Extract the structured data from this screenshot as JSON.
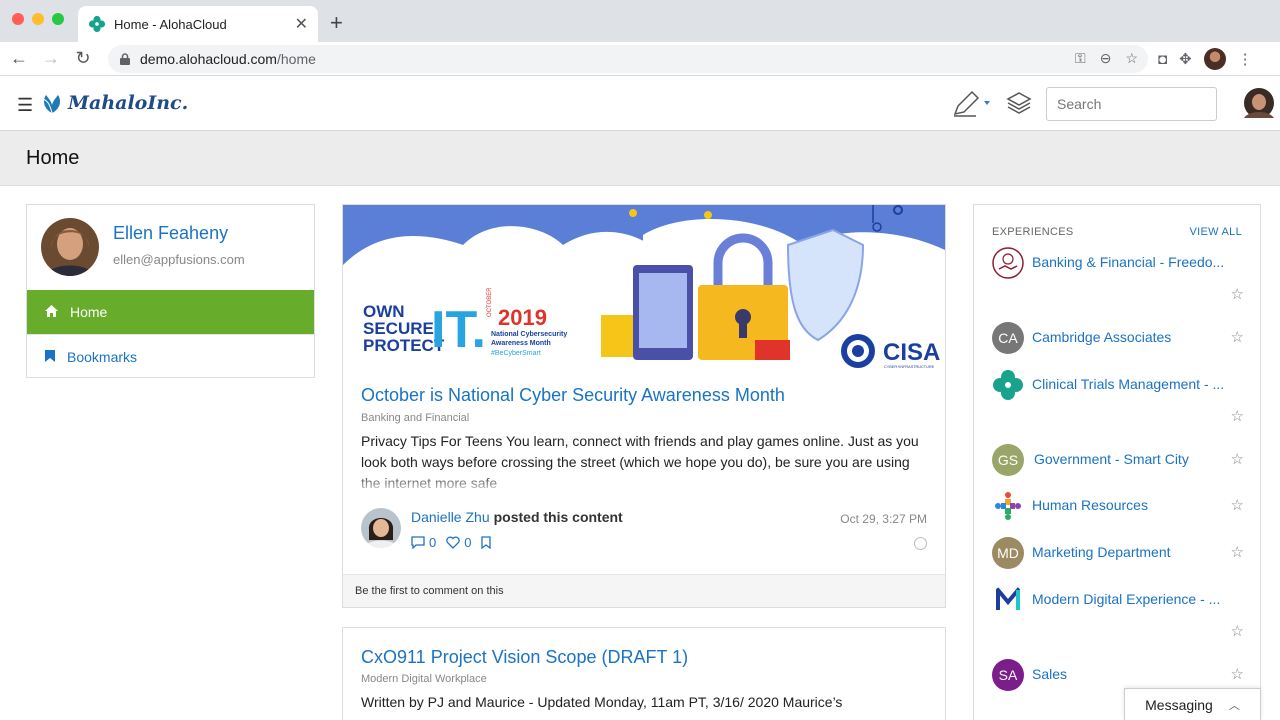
{
  "browser": {
    "tab_title": "Home - AlohaCloud",
    "url_host": "demo.alohacloud.com",
    "url_path": "/home"
  },
  "header": {
    "brand": "MahaloInc.",
    "search_placeholder": "Search"
  },
  "page": {
    "title": "Home"
  },
  "profile": {
    "name": "Ellen Feaheny",
    "email": "ellen@appfusions.com",
    "nav": [
      {
        "label": "Home",
        "icon": "home-icon",
        "active": true
      },
      {
        "label": "Bookmarks",
        "icon": "bookmark-icon",
        "active": false
      }
    ]
  },
  "feed": [
    {
      "title": "October is National Cyber Security Awareness Month",
      "place": "Banking and Financial",
      "body": "Privacy Tips For Teens You learn, connect with friends and play games online. Just as you look both ways before crossing the street (which we hope you do), be sure you are using the internet more safe",
      "author": "Danielle Zhu",
      "action": "posted this content",
      "time": "Oct 29, 3:27 PM",
      "comments": "0",
      "likes": "0",
      "comment_prompt": "Be the first to comment on this",
      "banner": {
        "line1": "OWN",
        "line2": "SECURE",
        "line3": "PROTECT",
        "it": "IT.",
        "year": "2019",
        "month": "OCTOBER",
        "subtitle1": "National Cybersecurity",
        "subtitle2": "Awareness Month",
        "hashtag": "#BeCyberSmart",
        "org": "CISA",
        "org_sub": "CYBER+INFRASTRUCTURE"
      }
    },
    {
      "title": "CxO911 Project Vision Scope (DRAFT 1)",
      "place": "Modern Digital Workplace",
      "body": "Written by PJ and Maurice - Updated Monday, 11am PT, 3/16/ 2020 Maurice’s"
    }
  ],
  "experiences": {
    "header": "EXPERIENCES",
    "view_all": "VIEW ALL",
    "items": [
      {
        "label": "Banking & Financial - Freedo...",
        "initials": "",
        "color": "#ffffff"
      },
      {
        "label": "Cambridge Associates",
        "initials": "CA",
        "color": "#777777"
      },
      {
        "label": "Clinical Trials Management - ...",
        "initials": "",
        "color": "#1aa38c"
      },
      {
        "label": "Government - Smart City",
        "initials": "GS",
        "color": "#9aa56a"
      },
      {
        "label": "Human Resources",
        "initials": "",
        "color": "#ffffff"
      },
      {
        "label": "Marketing Department",
        "initials": "MD",
        "color": "#9c8a62"
      },
      {
        "label": "Modern Digital Experience - ...",
        "initials": "",
        "color": "#ffffff"
      },
      {
        "label": "Sales",
        "initials": "SA",
        "color": "#7b1d8a"
      }
    ]
  },
  "messaging": {
    "label": "Messaging"
  }
}
